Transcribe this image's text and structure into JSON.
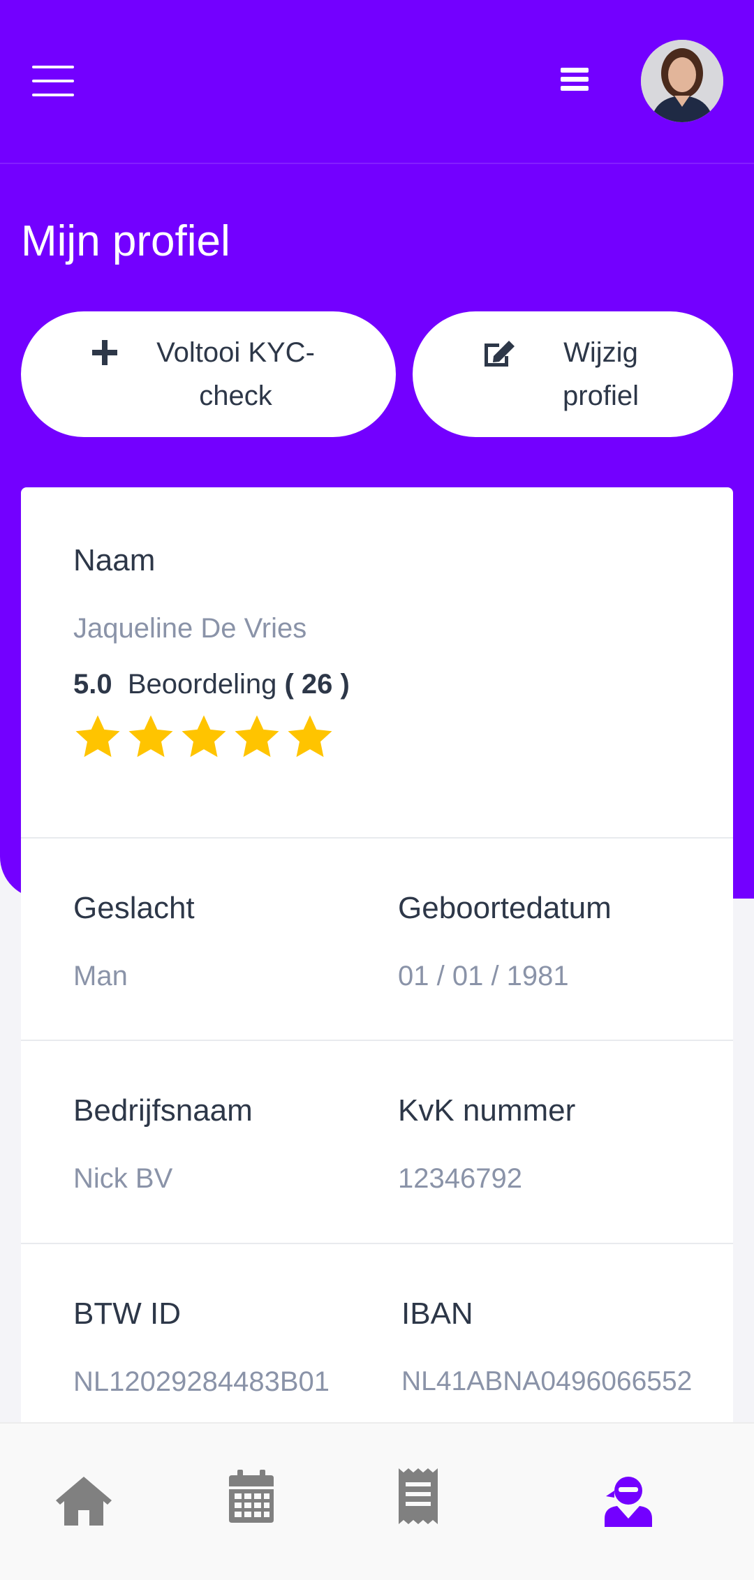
{
  "header": {
    "menu_icon": "hamburger-menu-icon",
    "list_icon": "list-icon",
    "avatar_alt": "profile-avatar"
  },
  "page": {
    "title": "Mijn profiel"
  },
  "actions": {
    "kyc_label": "Voltooi KYC-check",
    "kyc_icon": "plus-icon",
    "edit_label": "Wijzig profiel",
    "edit_icon": "edit-icon"
  },
  "profile": {
    "name_label": "Naam",
    "name_value": "Jaqueline De Vries",
    "rating_score": "5.0",
    "rating_label": "Beoordeling",
    "rating_count": "( 26 )",
    "stars": 5,
    "gender_label": "Geslacht",
    "gender_value": "Man",
    "birthdate_label": "Geboortedatum",
    "birthdate_value": "01 / 01 / 1981",
    "company_label": "Bedrijfsnaam",
    "company_value": "Nick BV",
    "kvk_label": "KvK nummer",
    "kvk_value": "12346792",
    "vat_label": "BTW ID",
    "vat_value": "NL12029284483B01",
    "iban_label": "IBAN",
    "iban_value": "NL41ABNA0496066552"
  },
  "bottom_nav": {
    "items": [
      "home-icon",
      "calendar-icon",
      "receipt-icon",
      "user-ninja-icon"
    ],
    "active_index": 3
  },
  "colors": {
    "primary": "#7300ff",
    "star": "#ffc400",
    "nav_inactive": "#808080"
  }
}
